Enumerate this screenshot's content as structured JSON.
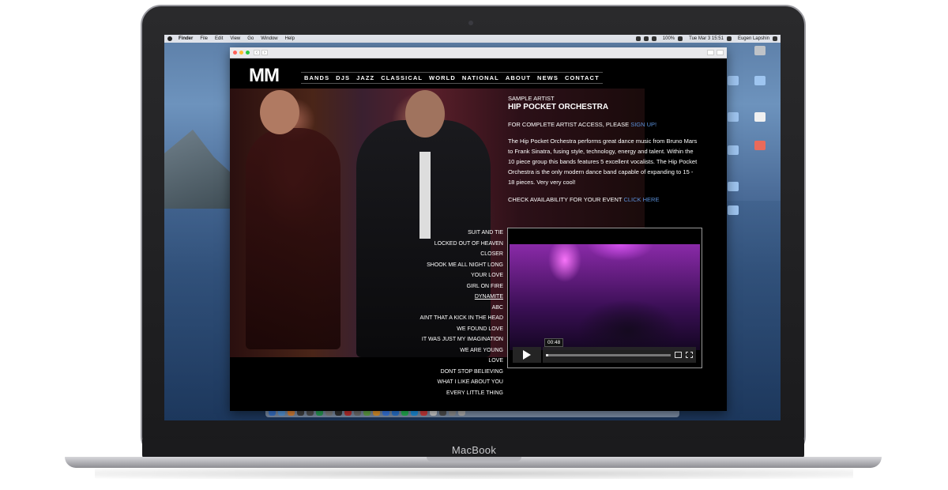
{
  "laptop": {
    "brand": "MacBook"
  },
  "menubar": {
    "items": [
      "Finder",
      "File",
      "Edit",
      "View",
      "Go",
      "Window",
      "Help"
    ],
    "battery": "100%",
    "clock": "Tue Mar 3  15:51",
    "user": "Eugen Lapshin"
  },
  "site": {
    "logo": "MM",
    "nav": [
      "BANDS",
      "DJS",
      "JAZZ",
      "CLASSICAL",
      "WORLD",
      "NATIONAL",
      "ABOUT",
      "NEWS",
      "CONTACT"
    ],
    "eyebrow": "SAMPLE ARTIST",
    "artist_name": "HIP POCKET ORCHESTRA",
    "access_text": "FOR COMPLETE ARTIST ACCESS, PLEASE",
    "access_link": "SIGN UP!",
    "description": "The Hip Pocket Orchestra performs great dance music from Bruno Mars to Frank Sinatra, fusing style, technology, energy and talent. Within the 10 piece group this bands features 5 excellent vocalists. The Hip Pocket Orchestra is the only modern dance band capable of expanding to 15 - 18 pieces. Very very cool!",
    "availability_text": "CHECK AVAILABILITY FOR YOUR EVENT",
    "availability_link": "CLICK HERE",
    "songs": [
      "SUIT AND TIE",
      "LOCKED OUT OF HEAVEN",
      "CLOSER",
      "SHOOK ME ALL NIGHT LONG",
      "YOUR LOVE",
      "GIRL ON FIRE",
      "DYNAMITE",
      "ABC",
      "AINT THAT A KICK IN THE HEAD",
      "WE FOUND LOVE",
      "IT WAS JUST MY IMAGINATION",
      "WE ARE YOUNG",
      "LOVE",
      "DONT STOP BELIEVING",
      "WHAT I LIKE ABOUT YOU",
      "EVERY LITTLE THING"
    ],
    "active_song_index": 6,
    "video": {
      "time": "00:48",
      "progress": 0.02
    }
  },
  "colors": {
    "link": "#5a8fd8",
    "background": "#000000"
  }
}
